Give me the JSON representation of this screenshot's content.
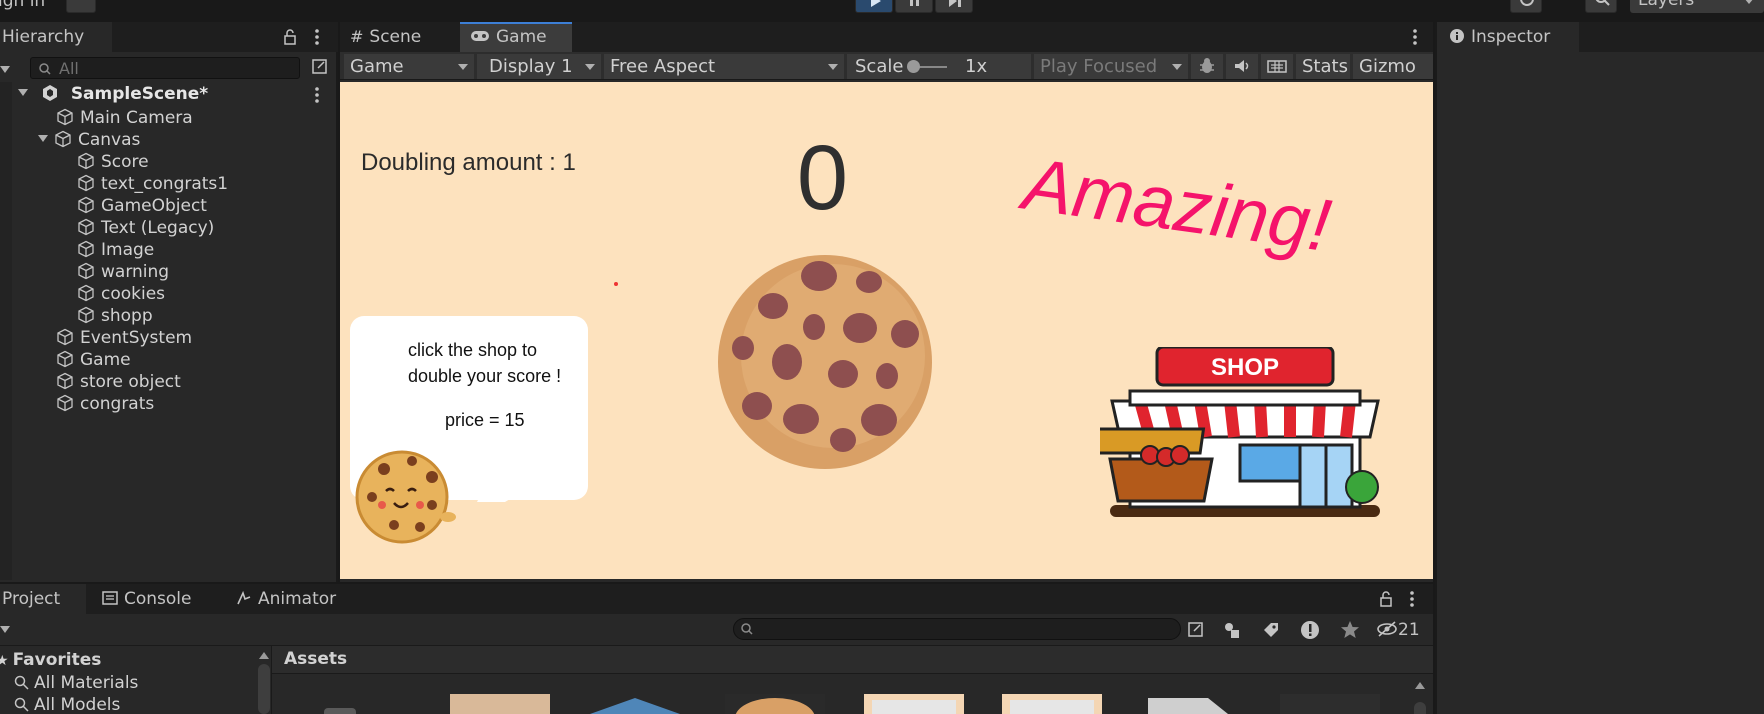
{
  "topbar": {
    "signin_label": "ign in",
    "layers_label": "Layers"
  },
  "hierarchy": {
    "tab_label": "Hierarchy",
    "search_placeholder": "All",
    "scene_name": "SampleScene*",
    "items": [
      {
        "label": "Main Camera"
      },
      {
        "label": "Canvas"
      },
      {
        "label": "Score"
      },
      {
        "label": "text_congrats1"
      },
      {
        "label": "GameObject"
      },
      {
        "label": "Text (Legacy)"
      },
      {
        "label": "Image"
      },
      {
        "label": "warning"
      },
      {
        "label": "cookies"
      },
      {
        "label": "shopp"
      },
      {
        "label": "EventSystem"
      },
      {
        "label": "Game"
      },
      {
        "label": "store object"
      },
      {
        "label": "congrats"
      }
    ]
  },
  "view_tabs": {
    "scene": "Scene",
    "game": "Game"
  },
  "game_toolbar": {
    "mode": "Game",
    "display": "Display 1",
    "aspect": "Free Aspect",
    "scale_label": "Scale",
    "scale_value": "1x",
    "play_focused": "Play Focused",
    "stats": "Stats",
    "gizmos": "Gizmo"
  },
  "game": {
    "doubling": "Doubling amount : 1",
    "score": "0",
    "amazing": "Amazing!",
    "bubble_line1": "click the shop to",
    "bubble_line2": "double your score !",
    "bubble_price": "price = 15",
    "shop_sign": "SHOP"
  },
  "inspector": {
    "tab_label": "Inspector"
  },
  "project": {
    "tabs": {
      "project": "Project",
      "console": "Console",
      "animator": "Animator"
    },
    "hidden_count": "21",
    "favorites_label": "Favorites",
    "favorites": [
      {
        "label": "All Materials"
      },
      {
        "label": "All Models"
      }
    ],
    "assets_label": "Assets"
  },
  "colors": {
    "game_bg": "#fde2be",
    "amazing": "#f5136b",
    "accent": "#3d7fd6"
  }
}
